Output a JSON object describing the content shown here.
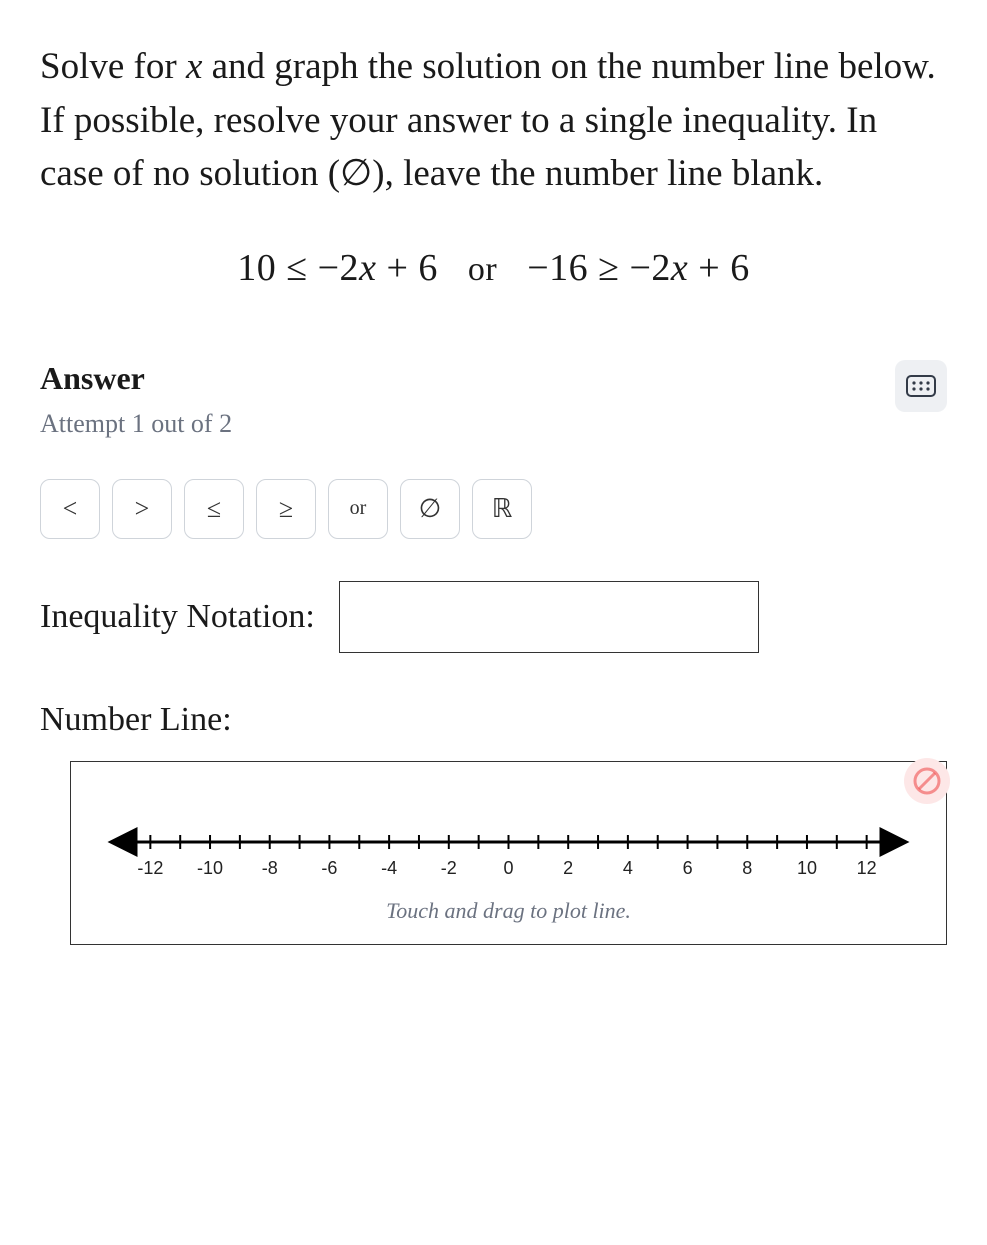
{
  "question": {
    "line1_pre": "Solve for ",
    "line1_var": "x",
    "line1_post": " and graph the solution on the number line below. If possible, resolve your answer to a single inequality. In case of no solution (∅), leave the number line blank."
  },
  "equation": {
    "lhs1": "10 ≤ −2",
    "var1": "x",
    "mid1": " + 6",
    "or": "or",
    "lhs2": "−16 ≥ −2",
    "var2": "x",
    "mid2": " + 6"
  },
  "answer_section": {
    "title": "Answer",
    "attempt": "Attempt 1 out of 2"
  },
  "toolbar": {
    "lt": "<",
    "gt": ">",
    "le": "≤",
    "ge": "≥",
    "or": "or",
    "empty": "∅",
    "reals": "ℝ"
  },
  "inequality": {
    "label": "Inequality Notation:",
    "value": ""
  },
  "number_line": {
    "label": "Number Line:",
    "caption": "Touch and drag to plot line.",
    "ticks": [
      "-12",
      "-10",
      "-8",
      "-6",
      "-4",
      "-2",
      "0",
      "2",
      "4",
      "6",
      "8",
      "10",
      "12"
    ]
  },
  "chart_data": {
    "type": "line",
    "title": "Number Line",
    "x": [
      -12,
      -10,
      -8,
      -6,
      -4,
      -2,
      0,
      2,
      4,
      6,
      8,
      10,
      12
    ],
    "xlim": [
      -13,
      13
    ],
    "series": [],
    "xlabel": "",
    "ylabel": ""
  }
}
